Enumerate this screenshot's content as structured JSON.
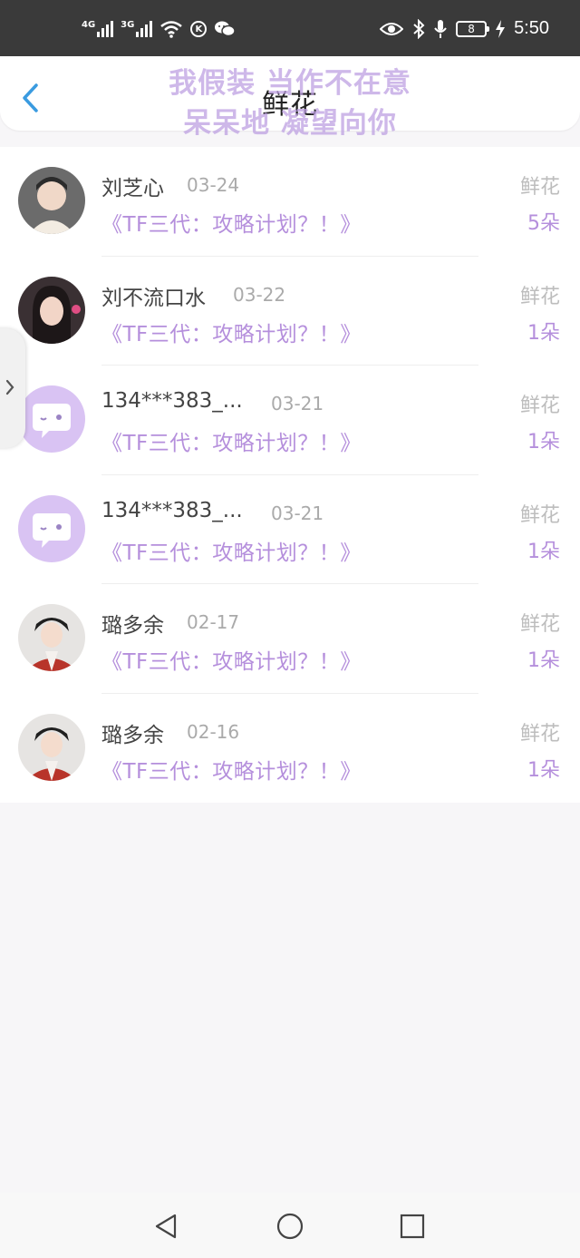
{
  "status_bar": {
    "net1": "4G",
    "net2": "3G",
    "k_badge": "K",
    "battery": "8",
    "time": "5:50"
  },
  "header": {
    "title": "鲜花",
    "overlay_line1": "我假装 当作不在意",
    "overlay_line2": "呆呆地 凝望向你"
  },
  "rows": [
    {
      "name": "刘芝心",
      "date": "03-24",
      "work": "《TF三代：攻略计划？！》",
      "gift": "鲜花",
      "count": "5朵",
      "avatar": "photo-avatar"
    },
    {
      "name": "刘不流口水",
      "date": "03-22",
      "work": "《TF三代：攻略计划？！》",
      "gift": "鲜花",
      "count": "1朵",
      "avatar": "photo-avatar"
    },
    {
      "name": "134***383_...",
      "date": "03-21",
      "work": "《TF三代：攻略计划？！》",
      "gift": "鲜花",
      "count": "1朵",
      "avatar": "default-chat-avatar"
    },
    {
      "name": "134***383_...",
      "date": "03-21",
      "work": "《TF三代：攻略计划？！》",
      "gift": "鲜花",
      "count": "1朵",
      "avatar": "default-chat-avatar"
    },
    {
      "name": "璐多余",
      "date": "02-17",
      "work": "《TF三代：攻略计划？！》",
      "gift": "鲜花",
      "count": "1朵",
      "avatar": "photo-avatar"
    },
    {
      "name": "璐多余",
      "date": "02-16",
      "work": "《TF三代：攻略计划？！》",
      "gift": "鲜花",
      "count": "1朵",
      "avatar": "photo-avatar"
    }
  ],
  "colors": {
    "accent_purple": "#b58fdc",
    "back_blue": "#3a9be0",
    "status_bar_bg": "#3a3a3a"
  }
}
